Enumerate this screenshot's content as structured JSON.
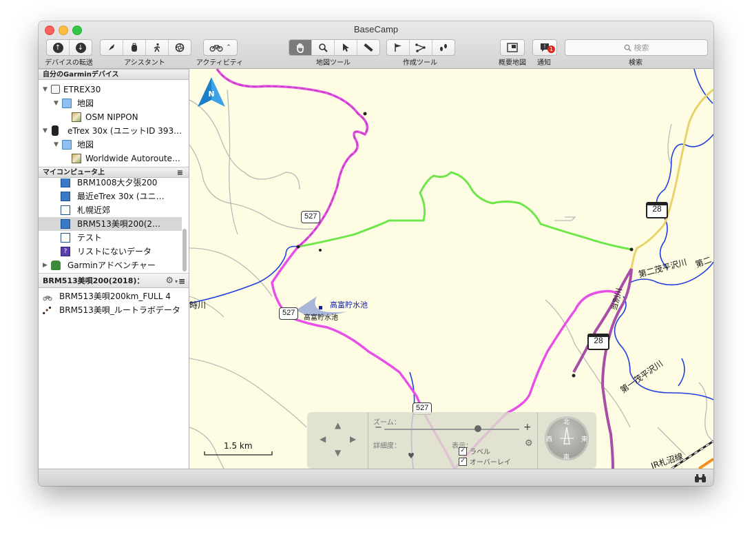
{
  "window": {
    "title": "BaseCamp"
  },
  "toolbar": {
    "groups": [
      {
        "label": "デバイスの転送",
        "buttons": [
          "upload-icon",
          "download-icon"
        ]
      },
      {
        "label": "アシスタント",
        "buttons": [
          "rocket-icon",
          "backpack-icon",
          "hiker-icon",
          "aperture-icon"
        ]
      },
      {
        "label": "アクティビティ",
        "buttons": [
          "bicycle-icon"
        ]
      },
      {
        "label": "地図ツール",
        "buttons": [
          "hand-icon",
          "magnifier-icon",
          "pointer-icon",
          "ruler-icon"
        ]
      },
      {
        "label": "作成ツール",
        "buttons": [
          "flag-icon",
          "route-icon",
          "footprints-icon"
        ]
      },
      {
        "label": "概要地図",
        "buttons": [
          "overview-map-icon"
        ]
      },
      {
        "label": "通知",
        "buttons": [
          "notification-icon"
        ]
      },
      {
        "label": "検索"
      }
    ],
    "notification_badge": "1",
    "search_placeholder": "検索"
  },
  "sidebar": {
    "devices_header": "自分のGarminデバイス",
    "devices": [
      {
        "label": "ETREX30",
        "level": 0
      },
      {
        "label": "地図",
        "level": 1
      },
      {
        "label": "OSM NIPPON",
        "level": 2
      },
      {
        "label": "eTrex 30x (ユニットID 393…",
        "level": 0
      },
      {
        "label": "地図",
        "level": 1
      },
      {
        "label": "Worldwide Autoroute…",
        "level": 2
      }
    ],
    "computer_header": "マイコンピュータ上",
    "computer_items": [
      {
        "label": "BRM1008大夕張200"
      },
      {
        "label": "最近eTrex 30x (ユニ…"
      },
      {
        "label": "札幌近郊"
      },
      {
        "label": "BRM513美唄200(2…",
        "selected": true
      },
      {
        "label": "テスト"
      },
      {
        "label": "リストにないデータ"
      },
      {
        "label": "Garminアドベンチャー"
      }
    ],
    "list_header": "BRM513美唄200(2018)：",
    "list_items": [
      {
        "label": "BRM513美唄200km_FULL 4",
        "icon": "bicycle-icon"
      },
      {
        "label": "BRM513美唄_ルートラボデータ",
        "icon": "footprints-icon"
      }
    ]
  },
  "map": {
    "compass_label": "N",
    "road_shields": [
      "527",
      "527",
      "527"
    ],
    "highway_shields": [
      "28",
      "28"
    ],
    "labels": {
      "reservoir_blue": "高富貯水池",
      "reservoir_black": "高富貯水池",
      "river_left": "時川",
      "river_right1": "第二茂平沢川",
      "river_right2": "第二",
      "river_vertical": "当別川",
      "river_right3": "第一茂平沢川",
      "railway": "JR札沼線"
    },
    "scale_label": "1.5 km",
    "nav_panel": {
      "zoom_label": "ズーム：",
      "zoom_minus": "−",
      "zoom_plus": "+",
      "detail_label": "詳細度：",
      "display_label": "表示：",
      "label_checkbox": "ラベル",
      "overlay_checkbox": "オーバーレイ",
      "compass_north": "北",
      "compass_south": "南",
      "compass_east": "東",
      "compass_west": "西"
    },
    "colors": {
      "background": "#fefde4",
      "route_magenta": "#e84fe8",
      "track_purple": "#b05ab0",
      "track_green": "#6ee64a",
      "river_blue": "#1f3fe0",
      "highway_yellow": "#e8d36a"
    }
  }
}
